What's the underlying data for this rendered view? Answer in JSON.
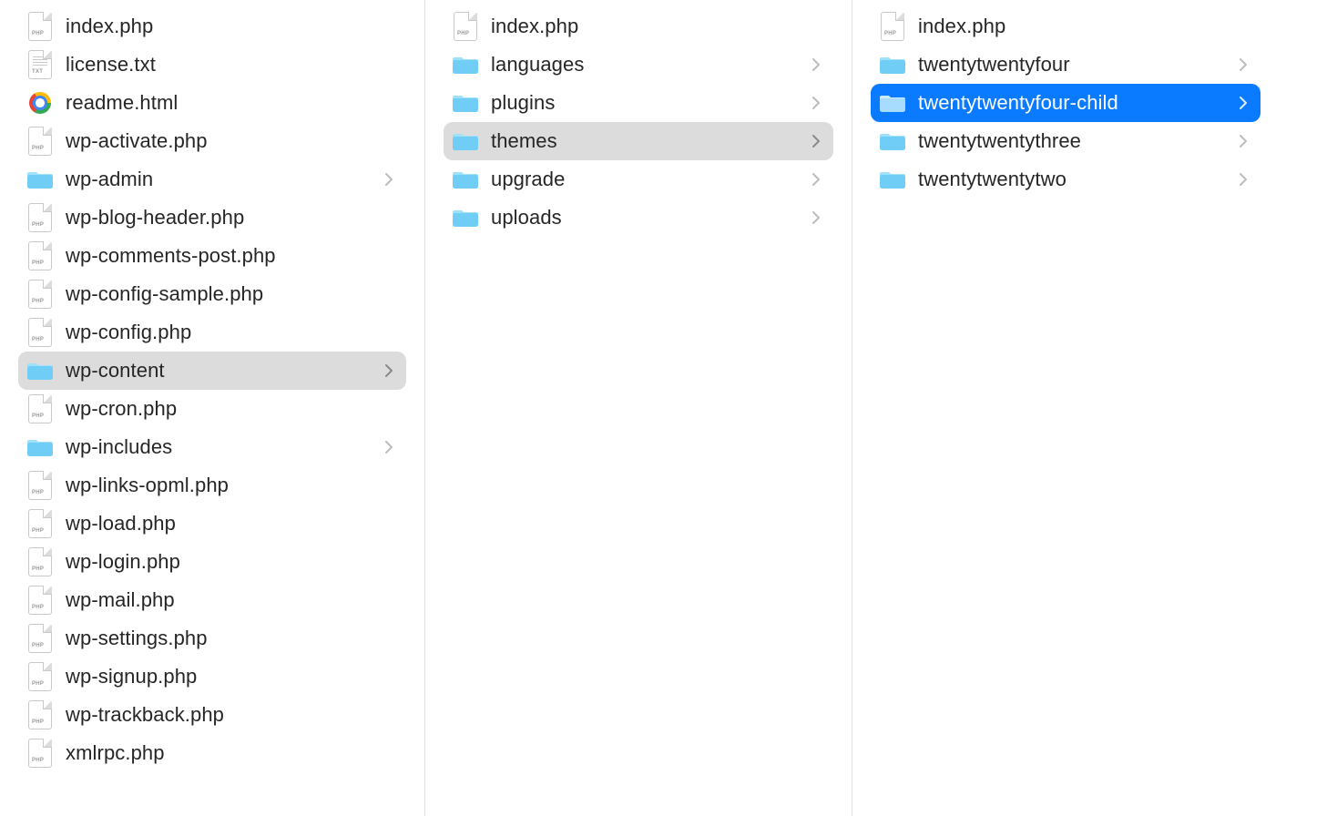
{
  "columns": [
    {
      "id": "root",
      "items": [
        {
          "name": "index.php",
          "type": "php",
          "folder": false,
          "selected": ""
        },
        {
          "name": "license.txt",
          "type": "txt",
          "folder": false,
          "selected": ""
        },
        {
          "name": "readme.html",
          "type": "html",
          "folder": false,
          "selected": ""
        },
        {
          "name": "wp-activate.php",
          "type": "php",
          "folder": false,
          "selected": ""
        },
        {
          "name": "wp-admin",
          "type": "folder",
          "folder": true,
          "selected": ""
        },
        {
          "name": "wp-blog-header.php",
          "type": "php",
          "folder": false,
          "selected": ""
        },
        {
          "name": "wp-comments-post.php",
          "type": "php",
          "folder": false,
          "selected": ""
        },
        {
          "name": "wp-config-sample.php",
          "type": "php",
          "folder": false,
          "selected": ""
        },
        {
          "name": "wp-config.php",
          "type": "php",
          "folder": false,
          "selected": ""
        },
        {
          "name": "wp-content",
          "type": "folder",
          "folder": true,
          "selected": "grey"
        },
        {
          "name": "wp-cron.php",
          "type": "php",
          "folder": false,
          "selected": ""
        },
        {
          "name": "wp-includes",
          "type": "folder",
          "folder": true,
          "selected": ""
        },
        {
          "name": "wp-links-opml.php",
          "type": "php",
          "folder": false,
          "selected": ""
        },
        {
          "name": "wp-load.php",
          "type": "php",
          "folder": false,
          "selected": ""
        },
        {
          "name": "wp-login.php",
          "type": "php",
          "folder": false,
          "selected": ""
        },
        {
          "name": "wp-mail.php",
          "type": "php",
          "folder": false,
          "selected": ""
        },
        {
          "name": "wp-settings.php",
          "type": "php",
          "folder": false,
          "selected": ""
        },
        {
          "name": "wp-signup.php",
          "type": "php",
          "folder": false,
          "selected": ""
        },
        {
          "name": "wp-trackback.php",
          "type": "php",
          "folder": false,
          "selected": ""
        },
        {
          "name": "xmlrpc.php",
          "type": "php",
          "folder": false,
          "selected": ""
        }
      ]
    },
    {
      "id": "wp-content",
      "items": [
        {
          "name": "index.php",
          "type": "php",
          "folder": false,
          "selected": ""
        },
        {
          "name": "languages",
          "type": "folder",
          "folder": true,
          "selected": ""
        },
        {
          "name": "plugins",
          "type": "folder",
          "folder": true,
          "selected": ""
        },
        {
          "name": "themes",
          "type": "folder",
          "folder": true,
          "selected": "grey"
        },
        {
          "name": "upgrade",
          "type": "folder",
          "folder": true,
          "selected": ""
        },
        {
          "name": "uploads",
          "type": "folder",
          "folder": true,
          "selected": ""
        }
      ]
    },
    {
      "id": "themes",
      "items": [
        {
          "name": "index.php",
          "type": "php",
          "folder": false,
          "selected": ""
        },
        {
          "name": "twentytwentyfour",
          "type": "folder",
          "folder": true,
          "selected": ""
        },
        {
          "name": "twentytwentyfour-child",
          "type": "folder",
          "folder": true,
          "selected": "blue"
        },
        {
          "name": "twentytwentythree",
          "type": "folder",
          "folder": true,
          "selected": ""
        },
        {
          "name": "twentytwentytwo",
          "type": "folder",
          "folder": true,
          "selected": ""
        }
      ]
    }
  ],
  "icons": {
    "php_badge": "PHP",
    "txt_badge": "TXT"
  },
  "colors": {
    "selection_blue": "#0a7bff",
    "selection_grey": "#dcdcdc",
    "folder_blue_light": "#7fd3f7",
    "folder_blue_dark": "#55c1f0"
  }
}
